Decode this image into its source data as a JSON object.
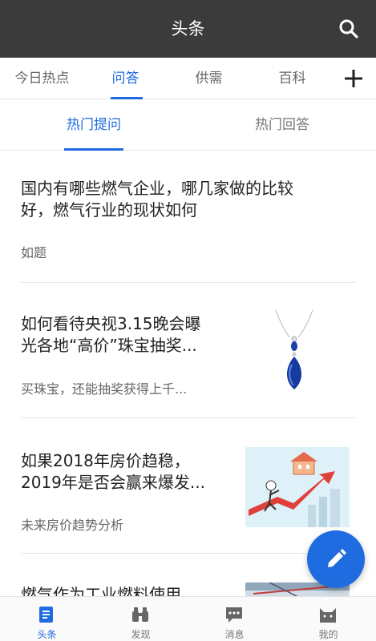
{
  "header": {
    "title": "头条",
    "search_icon": "search-icon"
  },
  "tabs": [
    {
      "label": "今日热点",
      "active": false
    },
    {
      "label": "问答",
      "active": true
    },
    {
      "label": "供需",
      "active": false
    },
    {
      "label": "百科",
      "active": false
    }
  ],
  "subtabs": [
    {
      "label": "热门提问",
      "active": true
    },
    {
      "label": "热门回答",
      "active": false
    }
  ],
  "feed": [
    {
      "line1": "国内有哪些燃气企业，哪几家做的比较",
      "line2": "好，燃气行业的现状如何",
      "sub": "如题",
      "thumb": "none"
    },
    {
      "line1": "如何看待央视3.15晚会曝",
      "line2": "光各地“高价”珠宝抽奖...",
      "sub": "买珠宝，还能抽奖获得上千...",
      "thumb": "blue-pendant-necklace"
    },
    {
      "line1": "如果2018年房价趋稳，",
      "line2": "2019年是否会赢来爆发...",
      "sub": "未来房价趋势分析",
      "thumb": "house-price-cartoon"
    },
    {
      "line1": "燃气作为工业燃料使用",
      "line2": "",
      "sub": "",
      "thumb": "industrial-photo"
    }
  ],
  "fab_icon": "pencil-icon",
  "bottom_nav": [
    {
      "label": "头条",
      "icon": "news-icon",
      "active": true
    },
    {
      "label": "发现",
      "icon": "binoculars-icon",
      "active": false
    },
    {
      "label": "消息",
      "icon": "message-icon",
      "active": false
    },
    {
      "label": "我的",
      "icon": "profile-icon",
      "active": false
    }
  ],
  "colors": {
    "accent": "#1f6be0",
    "topbar": "#3b3b3b"
  }
}
